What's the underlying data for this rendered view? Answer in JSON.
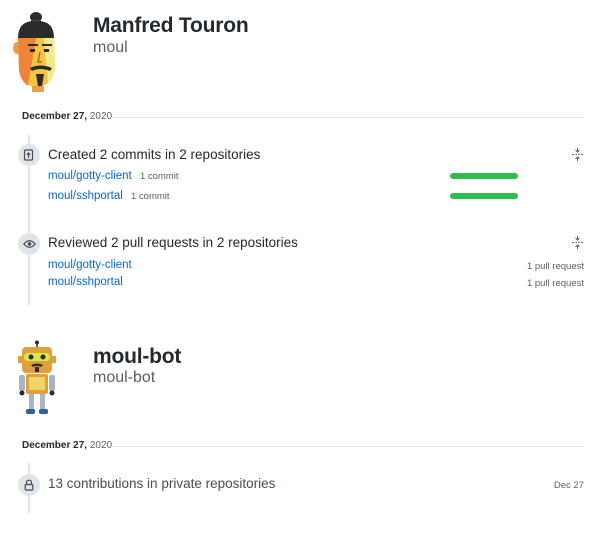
{
  "user1": {
    "name": "Manfred Touron",
    "login": "moul",
    "date_prefix": "December 27,",
    "date_year": "2020",
    "commits": {
      "title": "Created 2 commits in 2 repositories",
      "repos": [
        {
          "name": "moul/gotty-client",
          "count": "1 commit",
          "progress": 1.0
        },
        {
          "name": "moul/sshportal",
          "count": "1 commit",
          "progress": 1.0
        }
      ]
    },
    "reviews": {
      "title": "Reviewed 2 pull requests in 2 repositories",
      "repos": [
        {
          "name": "moul/gotty-client",
          "count": "1 pull request"
        },
        {
          "name": "moul/sshportal",
          "count": "1 pull request"
        }
      ]
    }
  },
  "user2": {
    "name": "moul-bot",
    "login": "moul-bot",
    "date_prefix": "December 27,",
    "date_year": "2020",
    "private": {
      "title": "13 contributions in private repositories",
      "date": "Dec 27"
    }
  },
  "colors": {
    "link": "#0366d6",
    "progress": "#2cbe4e",
    "muted": "#586069"
  },
  "icons": [
    "repo-push-icon",
    "eye-icon",
    "lock-icon",
    "fold-icon"
  ]
}
